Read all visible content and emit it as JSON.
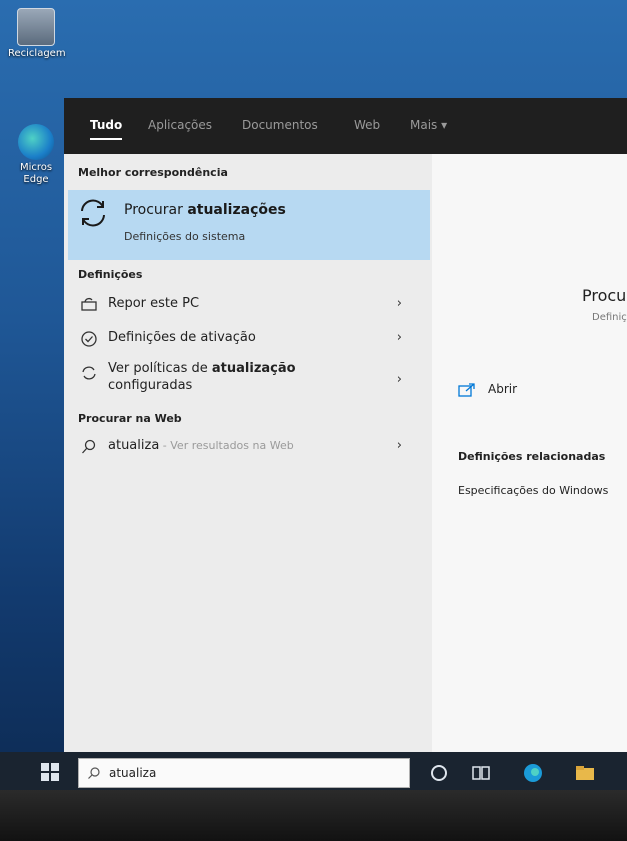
{
  "desktop": {
    "icons": [
      {
        "label": "Reciclagem",
        "icon": "recycle-bin-icon"
      },
      {
        "label": "Micros Edge",
        "icon": "edge-icon"
      }
    ]
  },
  "search_panel": {
    "tabs": [
      {
        "label": "Tudo"
      },
      {
        "label": "Aplicações"
      },
      {
        "label": "Documentos"
      },
      {
        "label": "Web"
      },
      {
        "label": "Mais ▾"
      }
    ],
    "best_match": {
      "heading": "Melhor correspondência",
      "title_prefix": "Procurar ",
      "title_bold": "atualizações",
      "subtitle": "Definições do sistema"
    },
    "settings": {
      "heading": "Definições",
      "items": [
        {
          "label": "Repor este PC",
          "icon": "laptop-reset-icon"
        },
        {
          "label": "Definições de ativação",
          "icon": "check-circle-icon"
        },
        {
          "label_prefix": "Ver políticas de ",
          "label_bold": "atualização",
          "label_suffix": " configuradas",
          "icon": "refresh-icon"
        }
      ]
    },
    "web": {
      "heading": "Procurar na Web",
      "query": "atualiza",
      "suffix": " - Ver resultados na Web"
    },
    "detail": {
      "title": "Procurar atualizações",
      "subtitle": "Definições do sistema",
      "open_label": "Abrir",
      "related_heading": "Definições relacionadas",
      "related_item": "Especificações do Windows"
    }
  },
  "taskbar": {
    "search_text": "atualiza"
  },
  "colors": {
    "highlight": "#b7d9f2",
    "topbar": "#1f1f1f",
    "accent": "#0078d7"
  }
}
